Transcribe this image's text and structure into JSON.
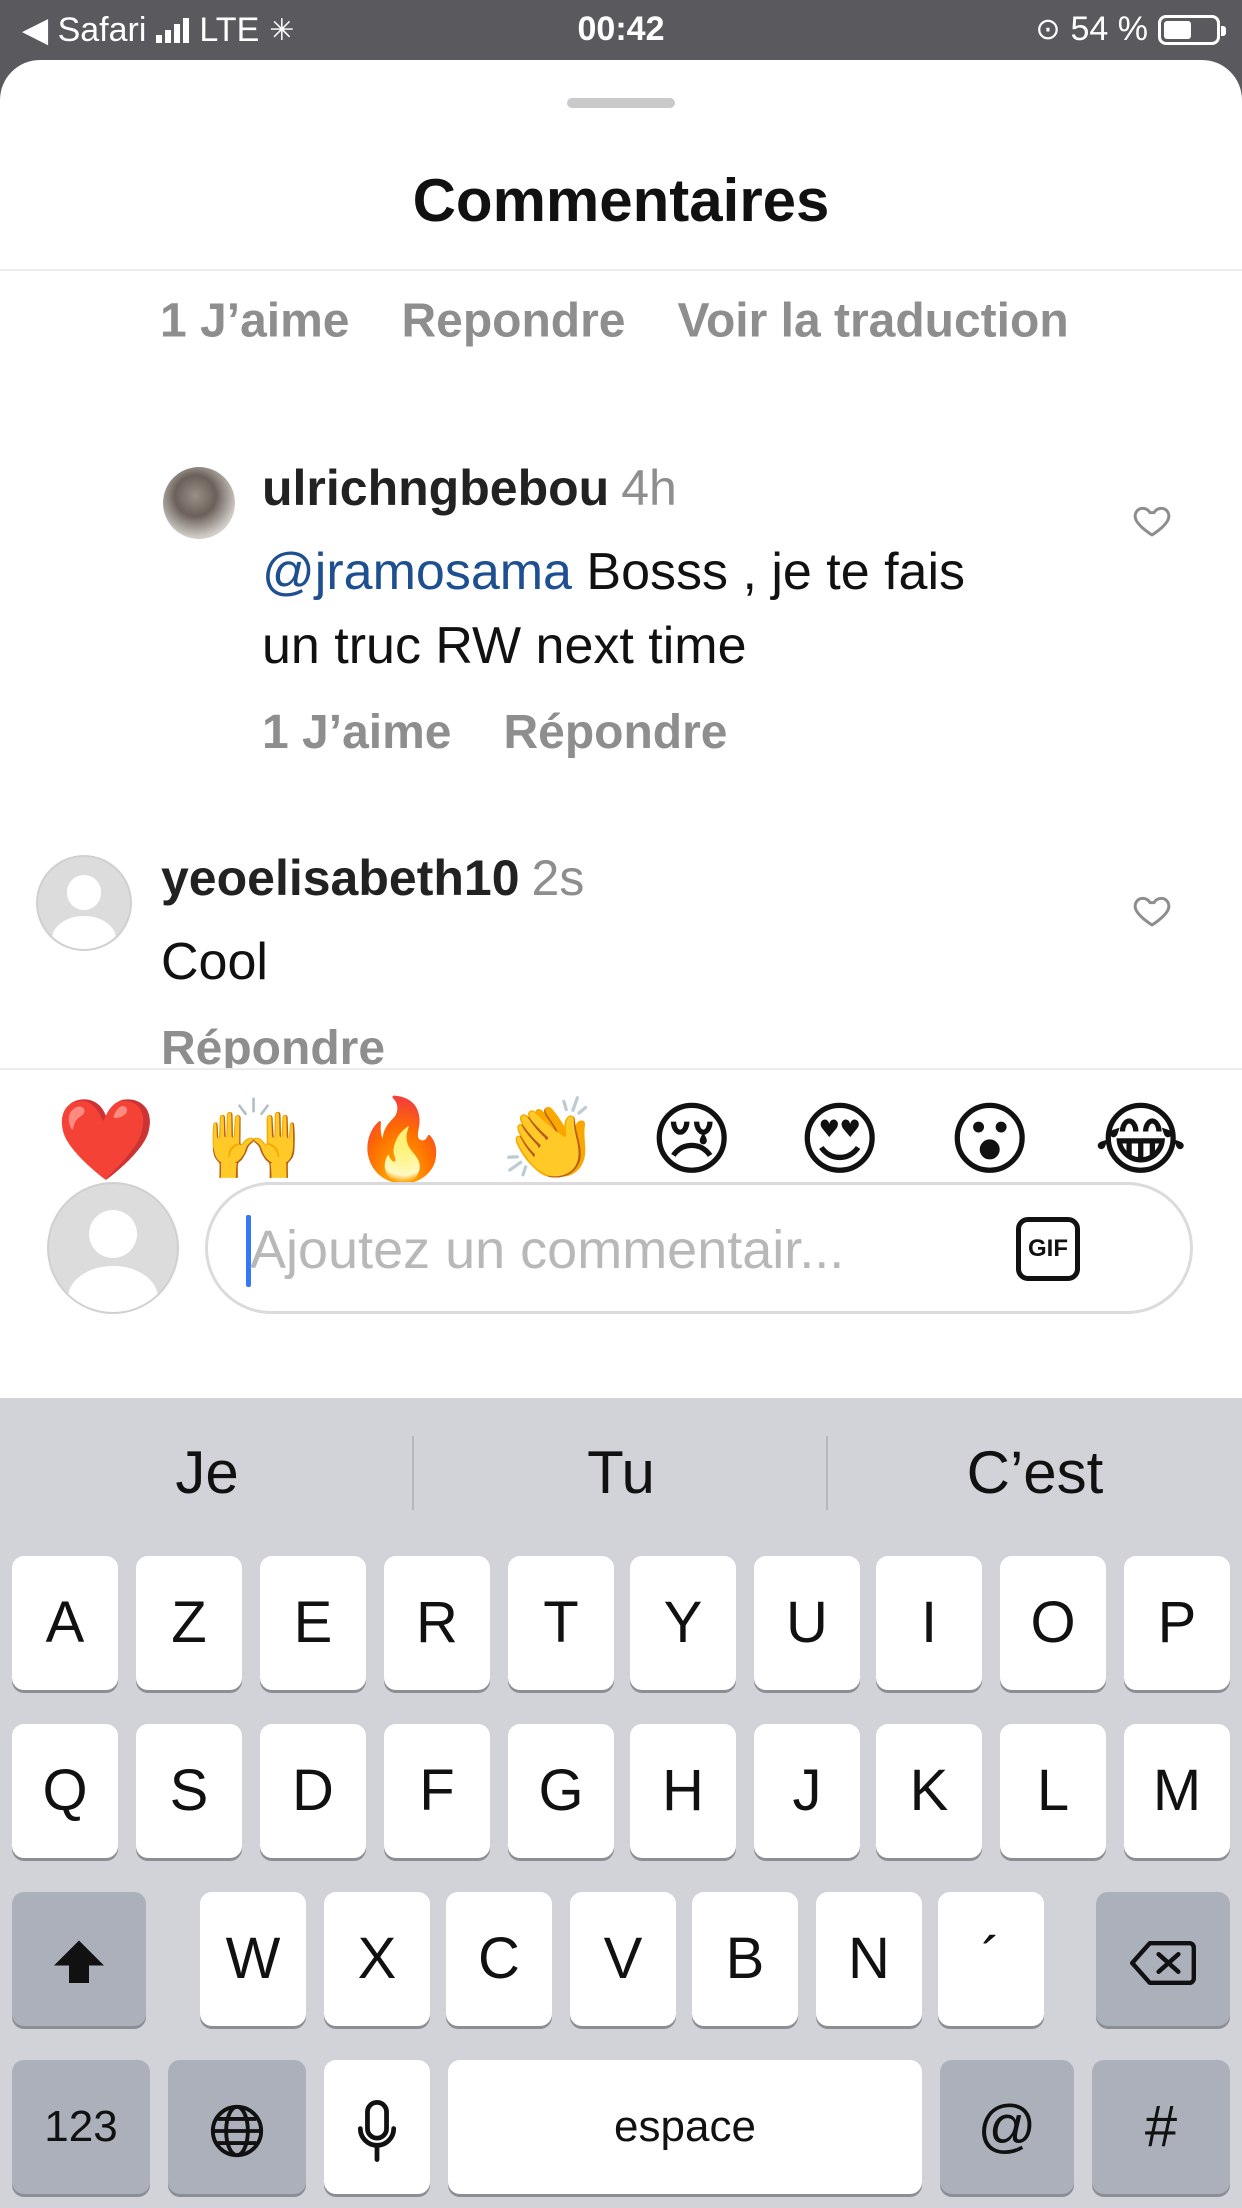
{
  "status_bar": {
    "back_label": "◀ Safari",
    "carrier": "LTE",
    "time": "00:42",
    "battery_percent": "54 %",
    "battery_level": 0.54
  },
  "sheet": {
    "title": "Commentaires"
  },
  "partial_actions": {
    "likes": "1 J’aime",
    "reply": "Repondre",
    "translate": "Voir la traduction"
  },
  "comments": [
    {
      "username": "ulrichngbebou",
      "time": "4h",
      "mention": "@jramosama",
      "text_line1": " Bosss , je te fais",
      "text_line2": "un truc RW next time",
      "likes": "1 J’aime",
      "reply": "Répondre",
      "avatar": "photo"
    },
    {
      "username": "yeoelisabeth10",
      "time": "2s",
      "text_line1": "Cool",
      "reply": "Répondre",
      "avatar": "default-avatar"
    }
  ],
  "emoji_reactions": [
    "❤️",
    "🙌",
    "🔥",
    "👏",
    "😢",
    "😍",
    "😮",
    "😂"
  ],
  "composer": {
    "placeholder": "Ajoutez un commentair...",
    "gif_label": "GIF"
  },
  "keyboard": {
    "suggestions": [
      "Je",
      "Tu",
      "C’est"
    ],
    "row1": [
      "A",
      "Z",
      "E",
      "R",
      "T",
      "Y",
      "U",
      "I",
      "O",
      "P"
    ],
    "row2": [
      "Q",
      "S",
      "D",
      "F",
      "G",
      "H",
      "J",
      "K",
      "L",
      "M"
    ],
    "row3": [
      "W",
      "X",
      "C",
      "V",
      "B",
      "N",
      "´"
    ],
    "numbers_label": "123",
    "space_label": "espace",
    "at_label": "@",
    "hash_label": "#"
  }
}
